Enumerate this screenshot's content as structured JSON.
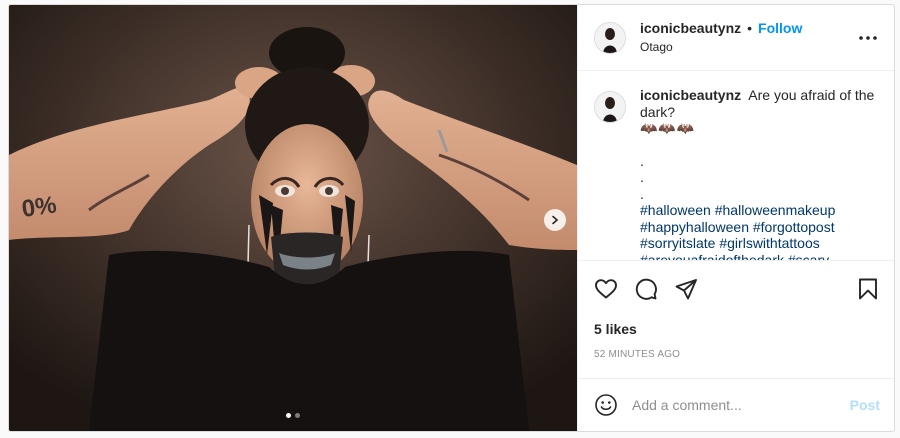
{
  "post": {
    "author": {
      "username": "iconicbeautynz",
      "follow_label": "Follow",
      "separator": "•",
      "location": "Otago"
    },
    "more_icon": "more-options-icon",
    "caption": {
      "username": "iconicbeautynz",
      "text": "Are you afraid of the dark?",
      "emoji": "🦇🦇🦇",
      "dots": [
        ".",
        ".",
        "."
      ],
      "hashtags": [
        "#halloween",
        "#halloweenmakeup",
        "#happyhalloween",
        "#forgottopost",
        "#sorryitslate",
        "#girlswithtattoos",
        "#areyouafraidofthedark",
        "#scary"
      ]
    },
    "carousel": {
      "slide_count": 2,
      "active_index": 0,
      "next_icon": "chevron-right-icon"
    },
    "actions": {
      "icons": [
        "heart-icon",
        "comment-icon",
        "share-icon",
        "bookmark-icon"
      ]
    },
    "likes_label": "5 likes",
    "timestamp": "52 MINUTES AGO",
    "comment_box": {
      "placeholder": "Add a comment...",
      "post_label": "Post",
      "emoji_icon": "smiley-icon"
    },
    "colors": {
      "accent": "#0095f6",
      "post_disabled": "#b2dffc",
      "hashtag": "#00376b",
      "muted": "#8e8e8e"
    }
  }
}
